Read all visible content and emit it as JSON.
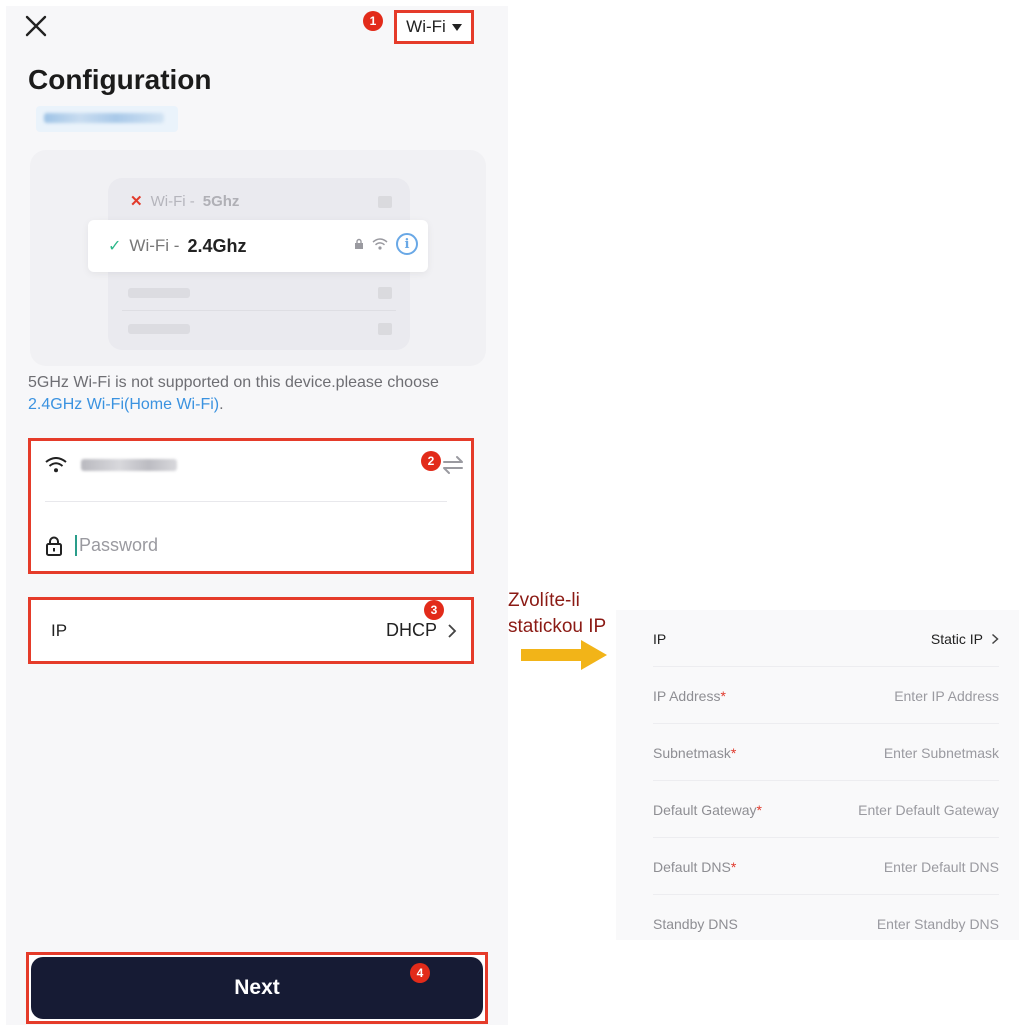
{
  "header": {
    "network_mode": "Wi-Fi",
    "title": "Configuration",
    "badge_1": "1"
  },
  "illustration": {
    "row1_label": "Wi-Fi -",
    "row1_band": "5Ghz",
    "selected_label": "Wi-Fi -",
    "selected_band": "2.4Ghz",
    "info_glyph": "i"
  },
  "note": {
    "text": "5GHz Wi-Fi is not supported on this device.please choose ",
    "link": "2.4GHz Wi-Fi(Home Wi-Fi)",
    "end": "."
  },
  "credentials": {
    "badge": "2",
    "password_placeholder": "Password"
  },
  "ip": {
    "label": "IP",
    "value": "DHCP",
    "badge": "3"
  },
  "next": {
    "label": "Next",
    "badge": "4"
  },
  "caption": {
    "line1": "Zvolíte-li",
    "line2": "statickou IP"
  },
  "static_ip": {
    "header_label": "IP",
    "header_value": "Static IP",
    "rows": [
      {
        "label": "IP Address",
        "required": "*",
        "placeholder": "Enter IP Address"
      },
      {
        "label": "Subnetmask",
        "required": "*",
        "placeholder": "Enter Subnetmask"
      },
      {
        "label": "Default Gateway",
        "required": "*",
        "placeholder": "Enter Default Gateway"
      },
      {
        "label": "Default DNS",
        "required": "*",
        "placeholder": "Enter Default DNS"
      },
      {
        "label": "Standby DNS",
        "required": "",
        "placeholder": "Enter Standby DNS"
      }
    ]
  },
  "colors": {
    "highlight_border": "#e53b2a",
    "badge": "#e22b1a",
    "next_button": "#161b34",
    "link": "#3a92e0",
    "caption": "#8b1a14",
    "arrow": "#f2b418"
  },
  "icons": [
    "close-icon",
    "caret-down-icon",
    "check-icon",
    "x-icon",
    "lock-icon",
    "wifi-icon",
    "info-icon",
    "swap-icon",
    "chevron-right-icon",
    "arrow-right-icon"
  ]
}
